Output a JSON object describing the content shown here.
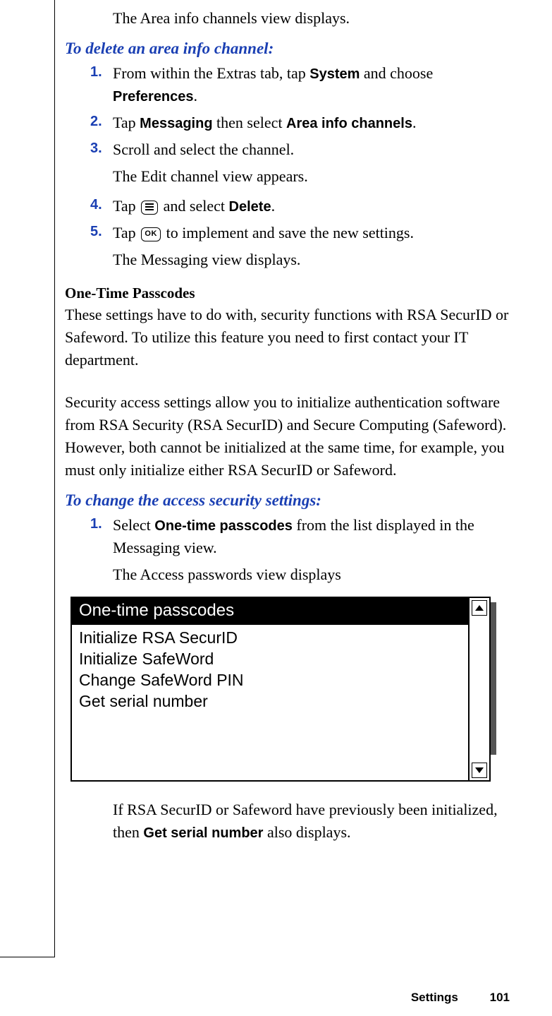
{
  "intro_line": "The Area info channels view displays.",
  "task1": {
    "heading": "To delete an area info channel:",
    "steps": {
      "s1": {
        "num": "1.",
        "pre": "From within the Extras tab, tap ",
        "b1": "System",
        "mid": " and choose ",
        "b2": "Preferences",
        "post": "."
      },
      "s2": {
        "num": "2.",
        "pre": "Tap ",
        "b1": "Messaging",
        "mid": " then select ",
        "b2": "Area info channels",
        "post": "."
      },
      "s3": {
        "num": "3.",
        "text": "Scroll and select the channel.",
        "extra": "The Edit channel view appears."
      },
      "s4": {
        "num": "4.",
        "pre": "Tap ",
        "post1": " and select ",
        "b1": "Delete",
        "post2": "."
      },
      "s5": {
        "num": "5.",
        "pre": "Tap ",
        "ok": "OK",
        "post": " to implement and save the new settings.",
        "extra": "The Messaging view displays."
      }
    }
  },
  "section2": {
    "heading": "One-Time Passcodes",
    "para1": "These settings have to do with, security functions with RSA SecurID or Safeword. To utilize this feature you need to first contact your IT department.",
    "para2": "Security access settings allow you to initialize authentication software from RSA Security (RSA SecurID) and Secure Computing (Safeword). However, both cannot be initialized at the same time, for example, you must only initialize either RSA SecurID or Safeword."
  },
  "task2": {
    "heading": "To change the access security settings:",
    "steps": {
      "s1": {
        "num": "1.",
        "pre": "Select ",
        "b1": "One-time passcodes",
        "post": " from the list displayed in the Messaging view.",
        "extra": "The Access passwords view displays"
      }
    }
  },
  "screenshot": {
    "title": "One-time passcodes",
    "items": [
      "Initialize RSA SecurID",
      "Initialize SafeWord",
      "Change SafeWord PIN",
      "Get serial number"
    ]
  },
  "after_screenshot": {
    "pre": "If RSA SecurID or Safeword have previously been initialized, then ",
    "b1": "Get serial number",
    "post": " also displays."
  },
  "footer": {
    "section": "Settings",
    "page": "101"
  }
}
